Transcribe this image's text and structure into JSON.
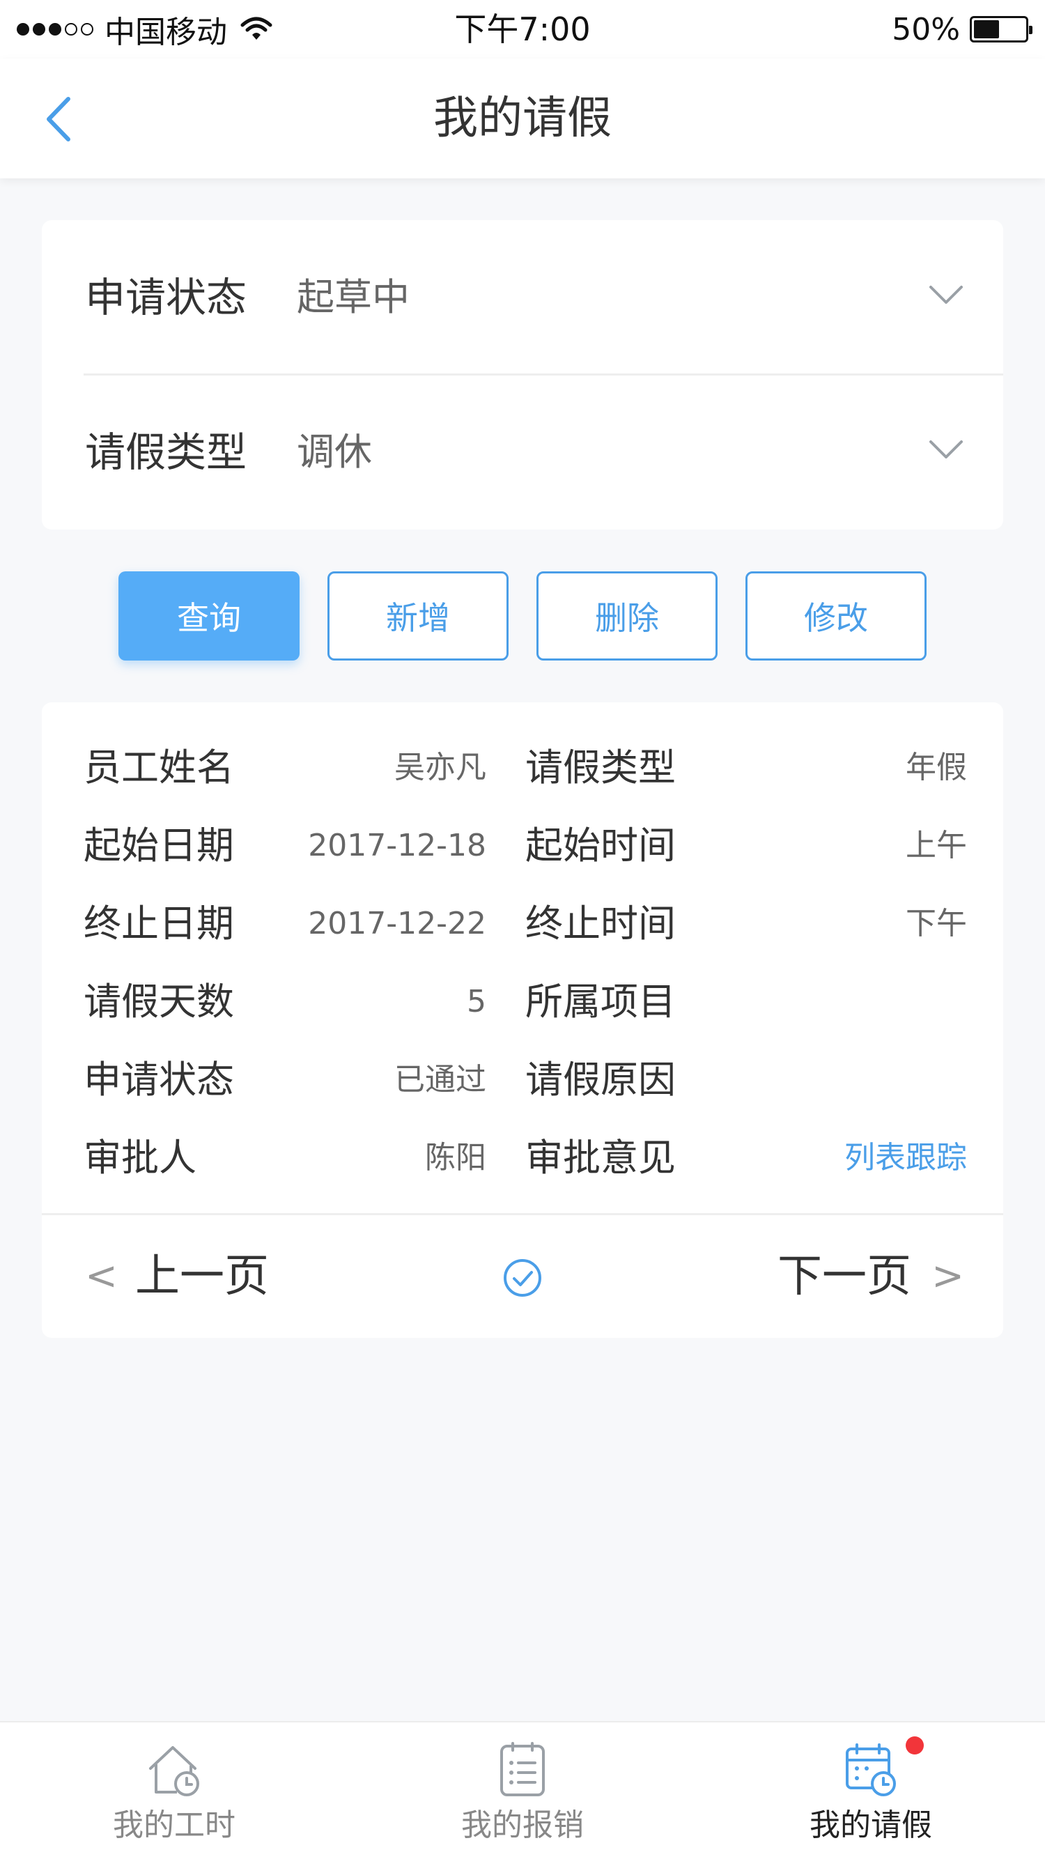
{
  "status_bar": {
    "carrier": "中国移动",
    "time": "下午7:00",
    "battery": "50%",
    "battery_level": 0.5
  },
  "nav": {
    "title": "我的请假",
    "back_icon": "chevron-left-icon"
  },
  "filters": [
    {
      "label": "申请状态",
      "value": "起草中"
    },
    {
      "label": "请假类型",
      "value": "调休"
    }
  ],
  "actions": {
    "query": "查询",
    "add": "新增",
    "delete": "删除",
    "edit": "修改"
  },
  "details": {
    "rows": [
      {
        "left_label": "员工姓名",
        "left_value": "吴亦凡",
        "right_label": "请假类型",
        "right_value": "年假"
      },
      {
        "left_label": "起始日期",
        "left_value": "2017-12-18",
        "right_label": "起始时间",
        "right_value": "上午"
      },
      {
        "left_label": "终止日期",
        "left_value": "2017-12-22",
        "right_label": "终止时间",
        "right_value": "下午"
      },
      {
        "left_label": "请假天数",
        "left_value": "5",
        "right_label": "所属项目",
        "right_value": ""
      },
      {
        "left_label": "申请状态",
        "left_value": "已通过",
        "right_label": "请假原因",
        "right_value": ""
      },
      {
        "left_label": "审批人",
        "left_value": "陈阳",
        "right_label": "审批意见",
        "right_value": "列表跟踪"
      }
    ]
  },
  "pager": {
    "prev_arrow": "<",
    "prev": "上一页",
    "next": "下一页",
    "next_arrow": ">"
  },
  "tabs": [
    {
      "label": "我的工时",
      "icon": "house-clock-icon",
      "active": false
    },
    {
      "label": "我的报销",
      "icon": "list-icon",
      "active": false
    },
    {
      "label": "我的请假",
      "icon": "calendar-clock-icon",
      "active": true
    }
  ],
  "colors": {
    "accent": "#4a9ee8",
    "primary_button": "#55acf7",
    "badge": "#f2353a",
    "background": "#f7f8fa"
  }
}
